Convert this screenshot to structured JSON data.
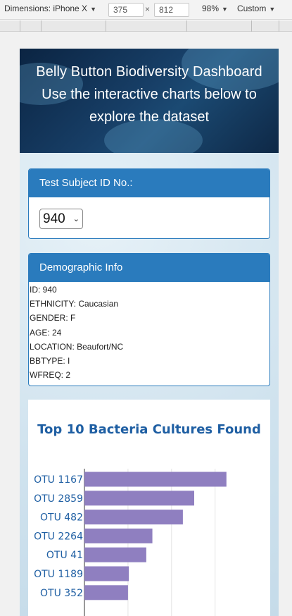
{
  "devtools": {
    "dimensions_label": "Dimensions: iPhone X",
    "width": "375",
    "height": "812",
    "zoom": "98%",
    "throttle": "Custom"
  },
  "header": {
    "title": "Belly Button Biodiversity Dashboard",
    "subtitle": "Use the interactive charts below to explore the dataset"
  },
  "subject_panel": {
    "heading": "Test Subject ID No.:",
    "selected_id": "940"
  },
  "demographics": {
    "heading": "Demographic Info",
    "lines": [
      "ID: 940",
      "ETHNICITY: Caucasian",
      "GENDER: F",
      "AGE: 24",
      "LOCATION: Beaufort/NC",
      "BBTYPE: I",
      "WFREQ: 2"
    ]
  },
  "chart_data": {
    "type": "bar",
    "orientation": "horizontal",
    "title": "Top 10 Bacteria Cultures Found",
    "categories": [
      "OTU 1167",
      "OTU 2859",
      "OTU 482",
      "OTU 2264",
      "OTU 41",
      "OTU 1189",
      "OTU 352"
    ],
    "values": [
      163,
      126,
      113,
      78,
      71,
      51,
      50
    ],
    "xlim": [
      0,
      210
    ],
    "grid": true,
    "bar_color": "#8f7fc0"
  }
}
